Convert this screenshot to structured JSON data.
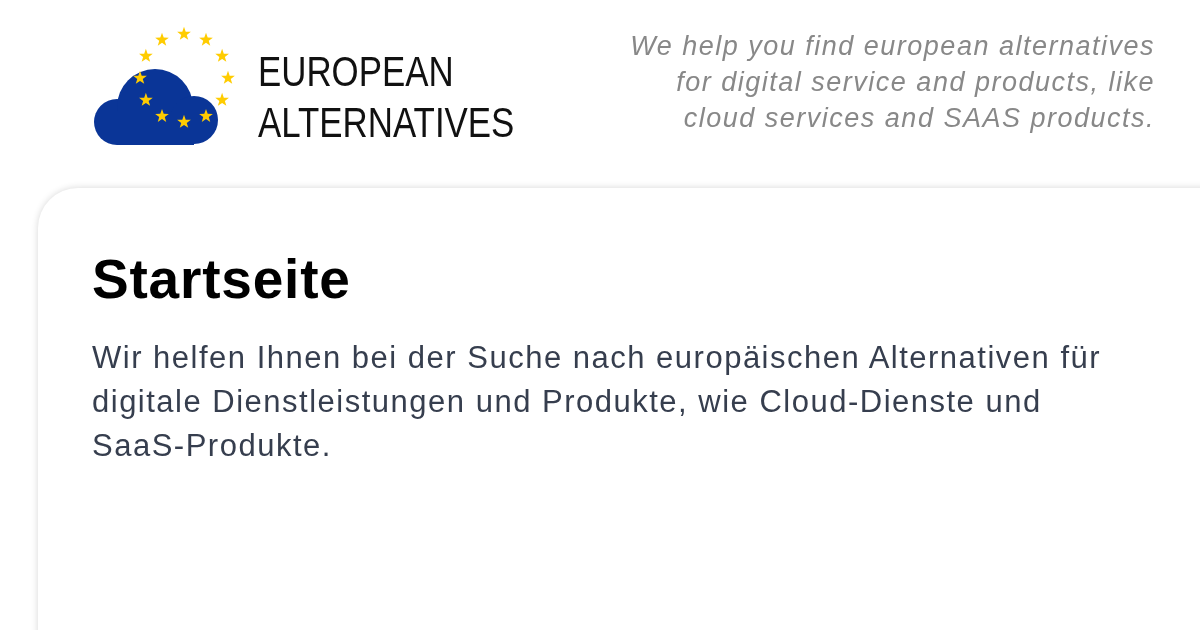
{
  "header": {
    "site_name": "EUROPEAN ALTERNATIVES",
    "tagline": "We help you find european alternatives for digital service and products, like cloud services and SAAS products."
  },
  "page": {
    "title": "Startseite",
    "intro": "Wir helfen Ihnen bei der Suche nach europäischen Alternativen für digitale Dienstleistungen und Produkte, wie Cloud-Dienste und SaaS-Produkte."
  }
}
